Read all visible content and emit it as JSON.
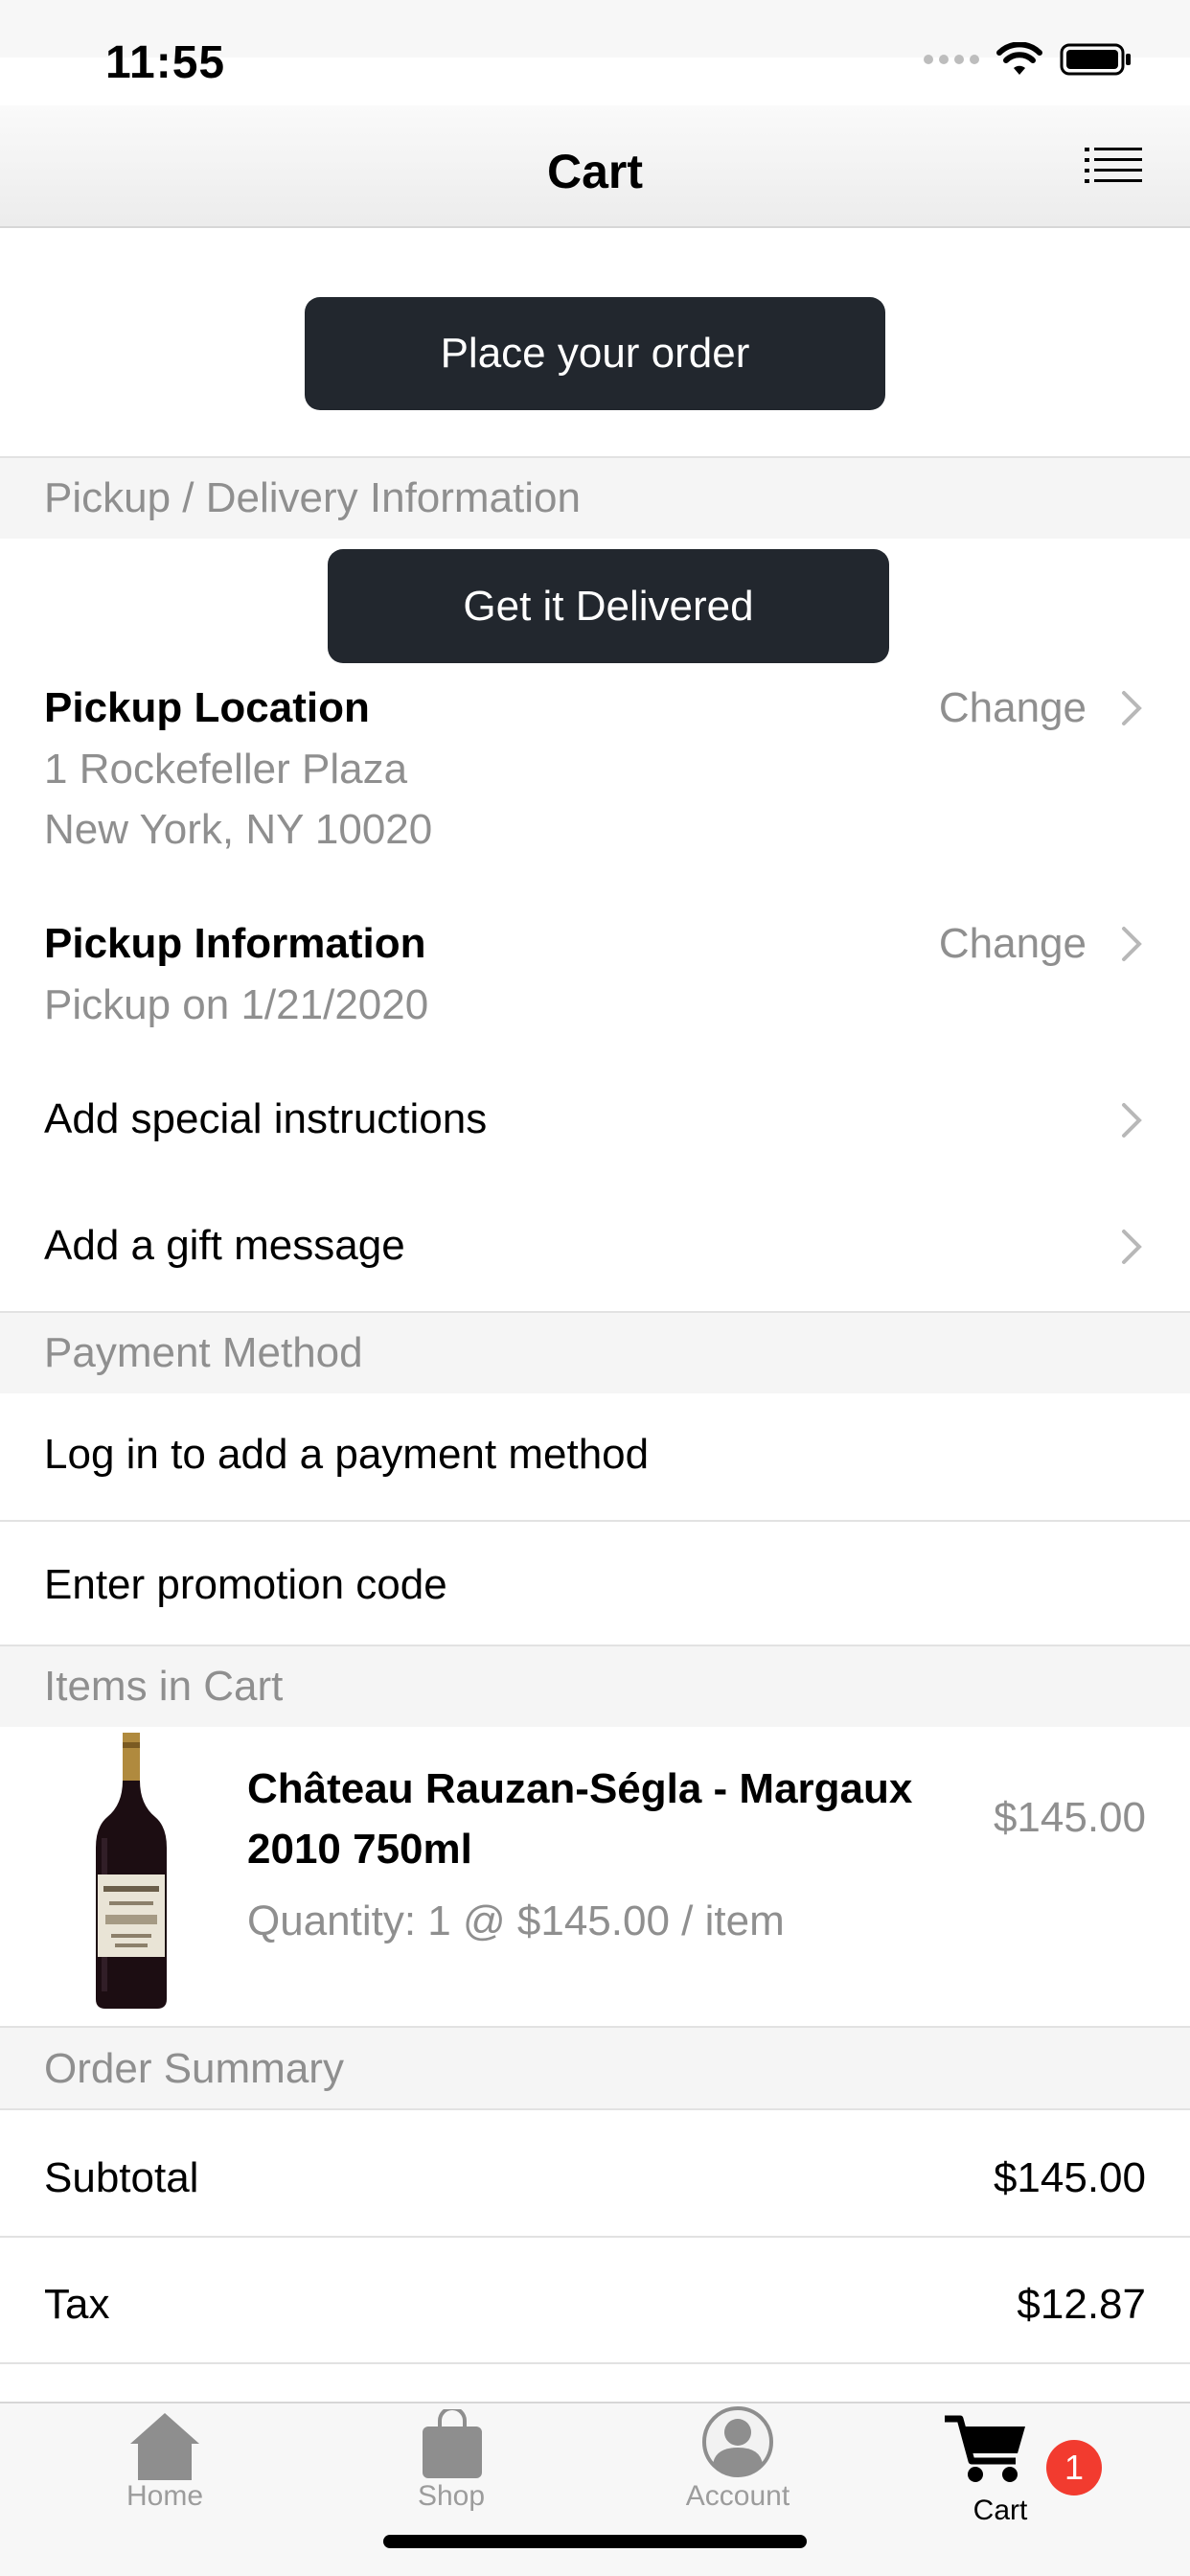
{
  "status_bar": {
    "time": "11:55"
  },
  "nav": {
    "title": "Cart"
  },
  "place_order_label": "Place your order",
  "sections": {
    "pickup_delivery": "Pickup / Delivery Information",
    "payment_method": "Payment Method",
    "items_in_cart": "Items in Cart",
    "order_summary": "Order Summary"
  },
  "delivery_button_label": "Get it Delivered",
  "pickup_location": {
    "title": "Pickup Location",
    "change_label": "Change",
    "address_line1": "1 Rockefeller Plaza",
    "address_line2": "New York, NY 10020"
  },
  "pickup_information": {
    "title": "Pickup Information",
    "change_label": "Change",
    "detail": "Pickup on 1/21/2020"
  },
  "special_instructions_label": "Add special instructions",
  "gift_message_label": "Add a gift message",
  "payment_login_label": "Log in to add a payment method",
  "promotion_label": "Enter promotion code",
  "cart_item": {
    "name": "Château Rauzan-Ségla - Margaux 2010 750ml",
    "quantity": "Quantity: 1 @ $145.00 / item",
    "price": "$145.00"
  },
  "summary": {
    "subtotal_label": "Subtotal",
    "subtotal_value": "$145.00",
    "tax_label": "Tax",
    "tax_value": "$12.87"
  },
  "tab_bar": {
    "home": "Home",
    "shop": "Shop",
    "account": "Account",
    "cart": "Cart",
    "cart_badge": "1"
  }
}
